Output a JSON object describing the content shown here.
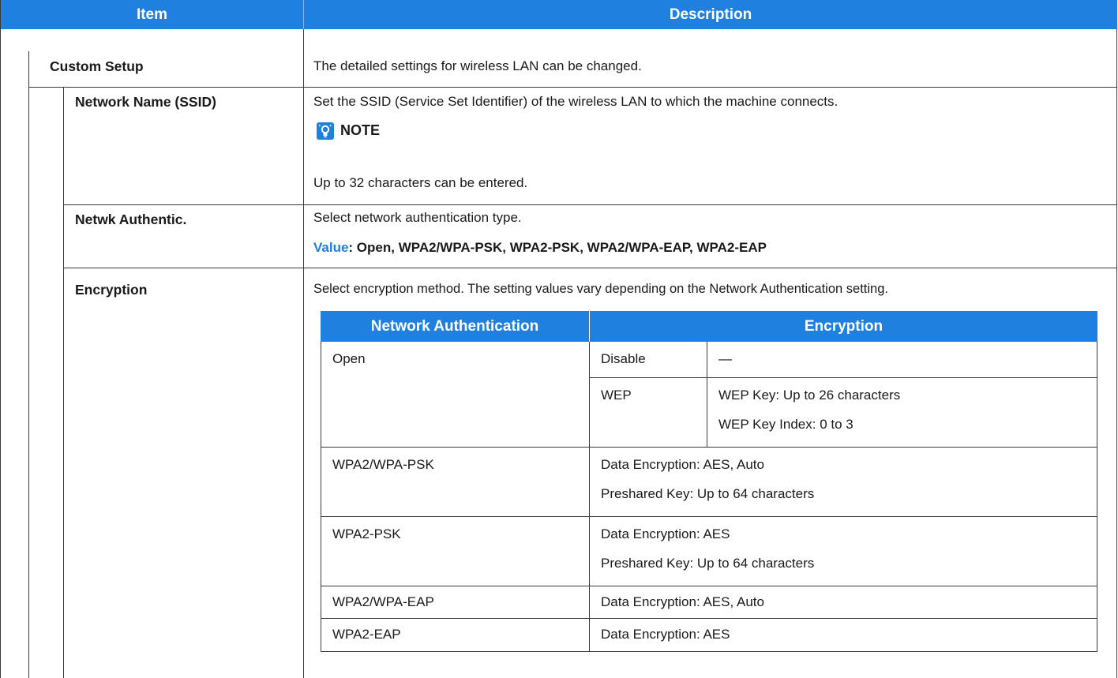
{
  "header": {
    "item": "Item",
    "description": "Description"
  },
  "rows": {
    "custom_setup": {
      "label": "Custom Setup",
      "description": "The detailed settings for wireless LAN can be changed."
    },
    "ssid": {
      "label": "Network Name (SSID)",
      "description": "Set the SSID (Service Set Identifier) of the wireless LAN to which the machine connects.",
      "note_title": "NOTE",
      "note_text": "Up to 32 characters can be entered."
    },
    "auth": {
      "label": "Netwk Authentic.",
      "description": "Select network authentication type.",
      "value_label": "Value",
      "value_text": ": Open, WPA2/WPA-PSK, WPA2-PSK, WPA2/WPA-EAP, WPA2-EAP"
    },
    "encryption": {
      "label": "Encryption",
      "description": "Select encryption method. The setting values vary depending on the Network Authentication setting."
    }
  },
  "enc_table": {
    "headers": [
      "Network Authentication",
      "Encryption"
    ],
    "open": {
      "name": "Open",
      "disable": "Disable",
      "disable_value": "—",
      "wep": "WEP",
      "wep_key": "WEP Key: Up to 26 characters",
      "wep_index": "WEP Key Index: 0 to 3"
    },
    "rows": [
      {
        "name": "WPA2/WPA-PSK",
        "line1": "Data Encryption: AES, Auto",
        "line2": "Preshared Key: Up to 64 characters"
      },
      {
        "name": "WPA2-PSK",
        "line1": "Data Encryption: AES",
        "line2": "Preshared Key: Up to 64 characters"
      },
      {
        "name": "WPA2/WPA-EAP",
        "line1": "Data Encryption: AES, Auto"
      },
      {
        "name": "WPA2-EAP",
        "line1": "Data Encryption: AES"
      }
    ]
  },
  "colors": {
    "accent": "#1f80df",
    "line": "#3a3a3a",
    "subline": "#c8c8c8"
  }
}
